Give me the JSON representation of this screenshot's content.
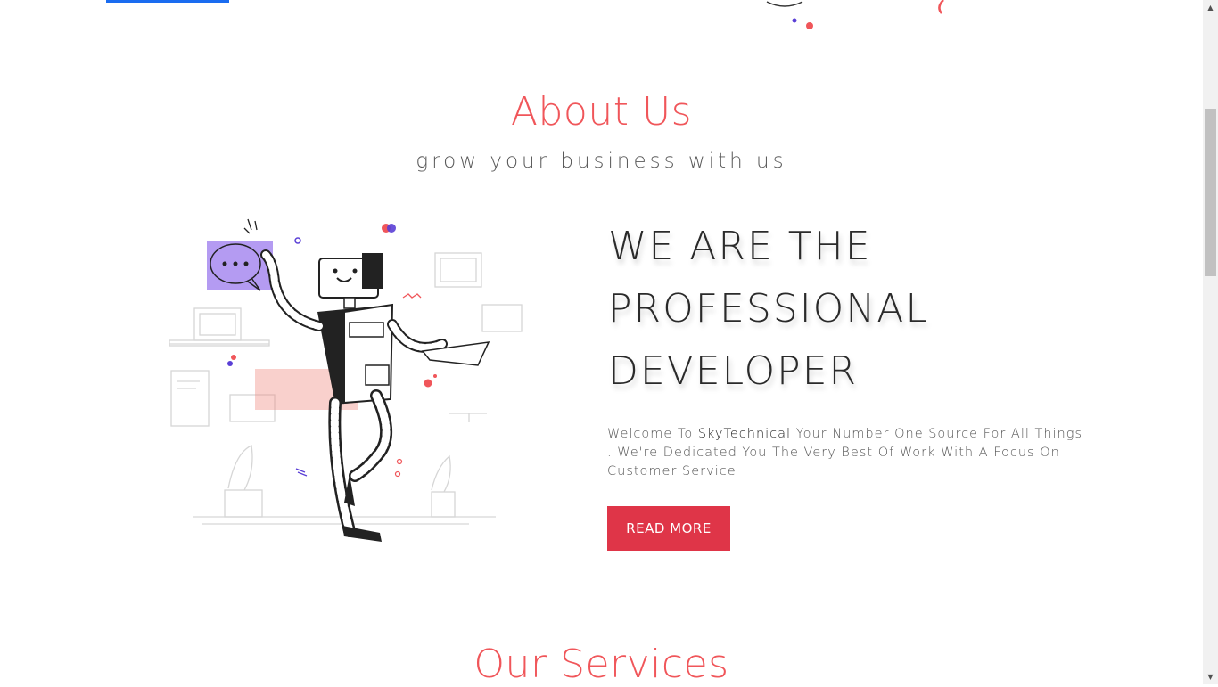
{
  "about": {
    "title": "About Us",
    "subtitle": "grow your business with us",
    "headline": [
      "WE ARE THE",
      "PROFESSIONAL",
      "DEVELOPER"
    ],
    "body_prefix": "Welcome To ",
    "brand": "SkyTechnical",
    "body_suffix": " Your Number One Source For All Things . We're Dedicated You The Very Best Of Work With A Focus On Customer Service",
    "cta_label": "READ MORE"
  },
  "services": {
    "title": "Our Services"
  },
  "colors": {
    "accent": "#f0565a",
    "button": "#df3548",
    "top_bar": "#1a6cf0"
  }
}
